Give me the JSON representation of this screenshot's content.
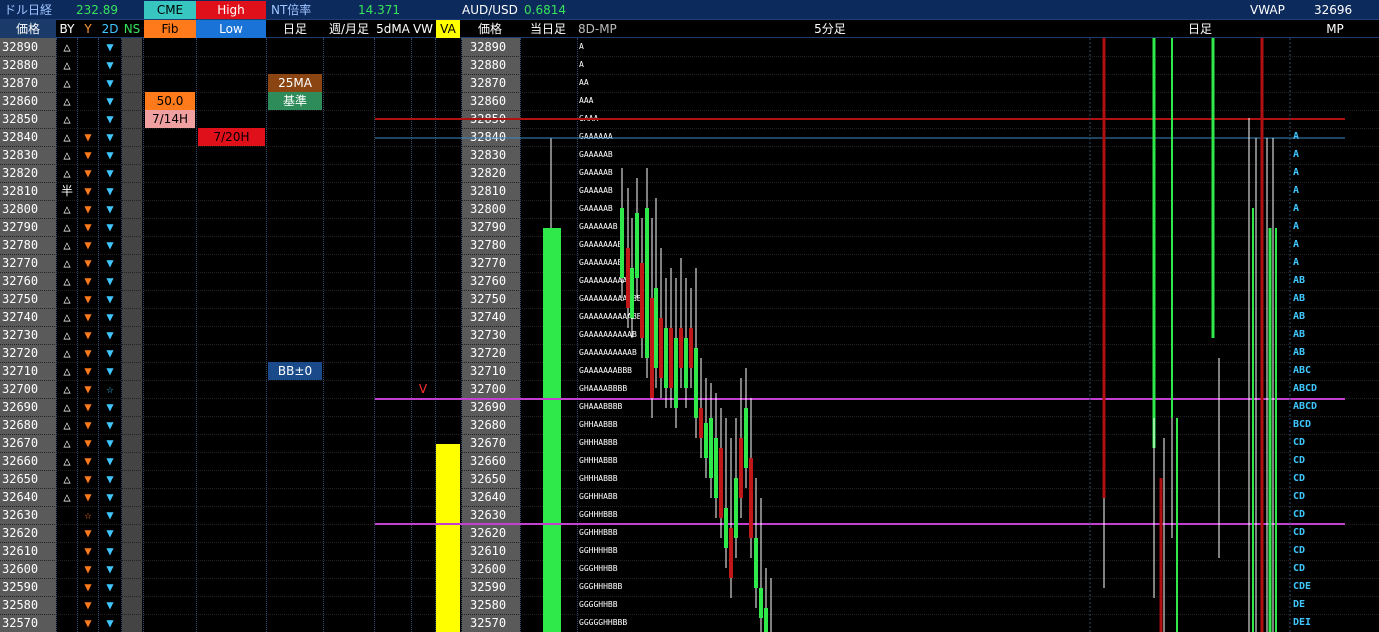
{
  "header": {
    "dollar_nikkei_label": "ドル日経",
    "dollar_nikkei_value": "232.89",
    "cme_label": "CME",
    "high_label": "High",
    "nt_ratio_label": "NT倍率",
    "nt_ratio_value": "14.371",
    "audusd_label": "AUD/USD",
    "audusd_value": "0.6814",
    "vwap_label": "VWAP",
    "vwap_value": "32696"
  },
  "columns": {
    "price": "価格",
    "by": "BY",
    "y": "Y",
    "two_d": "2D",
    "ns": "NS",
    "fib": "Fib",
    "low": "Low",
    "daily": "日足",
    "weekly_monthly": "週/月足",
    "ma5d": "5dMA",
    "vw": "VW",
    "va": "VA",
    "price2": "価格",
    "today_bar": "当日足",
    "mp8d": "8D-MP",
    "five_min": "5分足",
    "daily2": "日足",
    "mp": "MP"
  },
  "prices": [
    "32890",
    "32880",
    "32870",
    "32860",
    "32850",
    "32840",
    "32830",
    "32820",
    "32810",
    "32800",
    "32790",
    "32780",
    "32770",
    "32760",
    "32750",
    "32740",
    "32730",
    "32720",
    "32710",
    "32700",
    "32690",
    "32680",
    "32670",
    "32660",
    "32650",
    "32640",
    "32630",
    "32620",
    "32610",
    "32600",
    "32590",
    "32580",
    "32570"
  ],
  "by_marks": [
    "△",
    "△",
    "△",
    "△",
    "△",
    "△",
    "△",
    "△",
    "半",
    "△",
    "△",
    "△",
    "△",
    "△",
    "△",
    "△",
    "△",
    "△",
    "△",
    "△",
    "△",
    "△",
    "△",
    "△",
    "△",
    "△",
    "",
    "",
    "",
    "",
    "",
    "",
    ""
  ],
  "y_marks": [
    "",
    "",
    "",
    "",
    "",
    "▼",
    "▼",
    "▼",
    "▼",
    "▼",
    "▼",
    "▼",
    "▼",
    "▼",
    "▼",
    "▼",
    "▼",
    "▼",
    "▼",
    "▼",
    "▼",
    "▼",
    "▼",
    "▼",
    "▼",
    "▼",
    "☆",
    "▼",
    "▼",
    "▼",
    "▼",
    "▼",
    "▼"
  ],
  "two_d_marks": [
    "▼",
    "▼",
    "▼",
    "▼",
    "▼",
    "▼",
    "▼",
    "▼",
    "▼",
    "▼",
    "▼",
    "▼",
    "▼",
    "▼",
    "▼",
    "▼",
    "▼",
    "▼",
    "▼",
    "☆",
    "▼",
    "▼",
    "▼",
    "▼",
    "▼",
    "▼",
    "▼",
    "▼",
    "▼",
    "▼",
    "▼",
    "▼",
    "▼"
  ],
  "badges": {
    "fib_50": "50.0",
    "hi_714": "7/14H",
    "hi_720": "7/20H",
    "ma25": "25MA",
    "kijun": "基準",
    "bb": "BB±0",
    "vw_mark": "V"
  },
  "mp8d_letters": [
    "A",
    "A",
    "AA",
    "AAA",
    "GAAA",
    "GAAAAAA",
    "GAAAAAB",
    "GAAAAAB",
    "GAAAAAB",
    "GAAAAAB",
    "GAAAAAAB",
    "GAAAAAAAB",
    "GAAAAAAAB",
    "GAAAAAAAAAB",
    "GAAAAAAAAAABB",
    "GAAAAAAAAAABB",
    "GAAAAAAAAAAB",
    "GAAAAAAAAAAB",
    "GAAAAAAABBB",
    "GHAAAABBBB",
    "GHAAABBBB",
    "GHHAABBB",
    "GHHHABBB",
    "GHHHABBB",
    "GHHHABBB",
    "GGHHHABB",
    "GGHHHBBB",
    "GGHHHBBB",
    "GGHHHHBB",
    "GGGHHHBB",
    "GGGHHHBBB",
    "GGGGHHBB",
    "GGGGGHHBBB"
  ],
  "mp_letters": [
    "",
    "",
    "",
    "",
    "",
    "A",
    "A",
    "A",
    "A",
    "A",
    "A",
    "A",
    "A",
    "AB",
    "AB",
    "AB",
    "AB",
    "AB",
    "ABC",
    "ABCD",
    "ABCD",
    "BCD",
    "CD",
    "CD",
    "CD",
    "CD",
    "CD",
    "CD",
    "CD",
    "CD",
    "CDE",
    "DE",
    "DEI"
  ],
  "colors": {
    "bg": "#000000",
    "header_bg": "#0c2a5c",
    "green": "#2fe84a",
    "yellow": "#ffff00",
    "orange": "#ff7a1a",
    "cyan": "#3fc8ff",
    "red": "#cc1010",
    "magenta": "#c23fd0",
    "cme_bg": "#37c7c0",
    "high_bg": "#e0101a",
    "fib_bg": "#ff7a1a",
    "low_bg": "#1a74d8",
    "va_bg": "#ffff00"
  }
}
